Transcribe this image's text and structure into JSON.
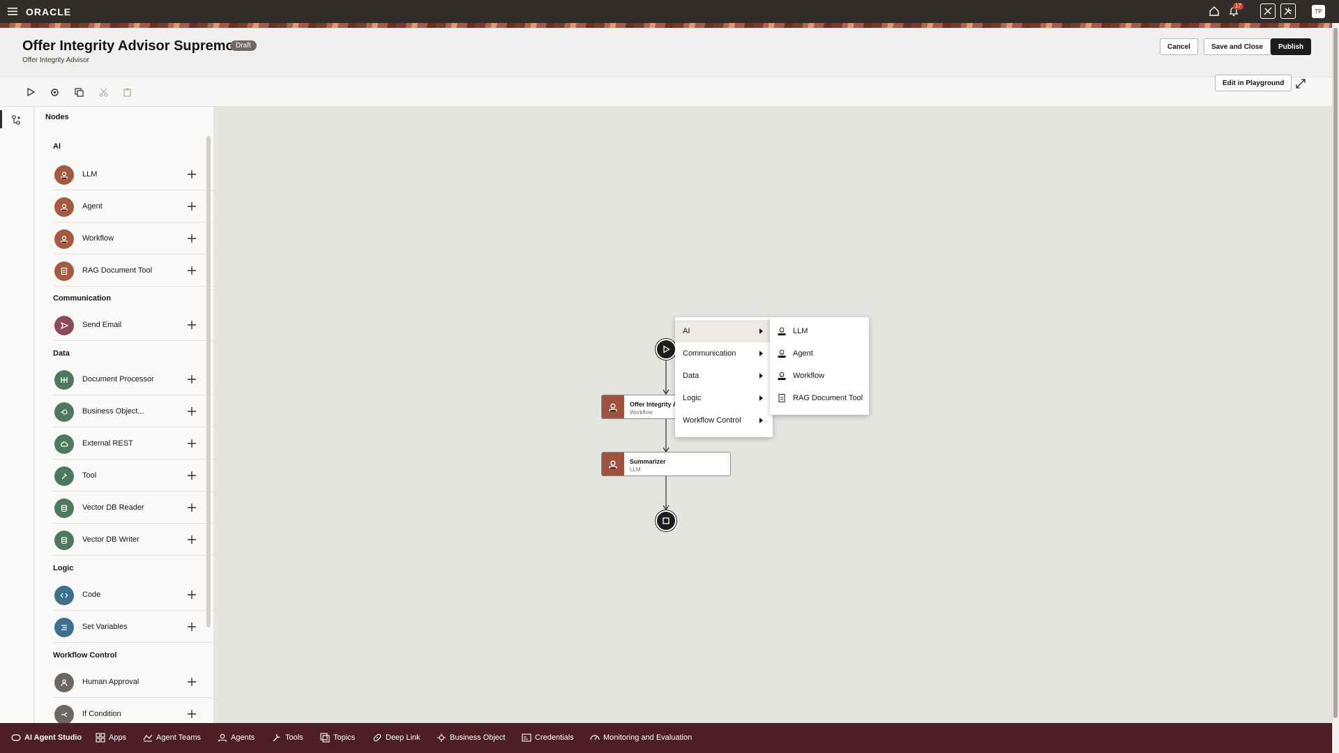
{
  "topbar": {
    "brand": "ORACLE",
    "notification_count": "17",
    "avatar_initials": "TP"
  },
  "header": {
    "title": "Offer Integrity Advisor Supremo",
    "status_badge": "Draft",
    "subtitle": "Offer Integrity Advisor",
    "cancel_label": "Cancel",
    "save_close_label": "Save and Close",
    "publish_label": "Publish"
  },
  "toolbar": {
    "edit_playground_label": "Edit in Playground"
  },
  "palette": {
    "title": "Nodes",
    "categories": {
      "ai": "AI",
      "communication": "Communication",
      "data": "Data",
      "logic": "Logic",
      "workflow_control": "Workflow Control"
    },
    "items": [
      {
        "label": "LLM",
        "icon": "llm-icon",
        "color": "#a35a41"
      },
      {
        "label": "Agent",
        "icon": "agent-icon",
        "color": "#a35a41"
      },
      {
        "label": "Workflow",
        "icon": "workflow-icon",
        "color": "#a35a41"
      },
      {
        "label": "RAG Document Tool",
        "icon": "rag-document-icon",
        "color": "#a35a41"
      },
      {
        "label": "Send Email",
        "icon": "send-icon",
        "color": "#8c4b5a"
      },
      {
        "label": "Document Processor",
        "icon": "document-processor-icon",
        "color": "#4d7a5e"
      },
      {
        "label": "Business Object...",
        "icon": "business-object-icon",
        "color": "#4d7a5e"
      },
      {
        "label": "External REST",
        "icon": "cloud-icon",
        "color": "#4d7a5e"
      },
      {
        "label": "Tool",
        "icon": "tool-icon",
        "color": "#4d7a5e"
      },
      {
        "label": "Vector DB Reader",
        "icon": "database-icon",
        "color": "#4d7a5e"
      },
      {
        "label": "Vector DB Writer",
        "icon": "database-icon",
        "color": "#4d7a5e"
      },
      {
        "label": "Code",
        "icon": "code-icon",
        "color": "#3f6f8e"
      },
      {
        "label": "Set Variables",
        "icon": "list-icon",
        "color": "#3f6f8e"
      },
      {
        "label": "Human Approval",
        "icon": "person-icon",
        "color": "#6b6762"
      },
      {
        "label": "If Condition",
        "icon": "branch-icon",
        "color": "#6b6762"
      }
    ]
  },
  "canvas": {
    "nodes": [
      {
        "title": "Offer Integrity Ac",
        "type": "Workflow"
      },
      {
        "title": "Summarizer",
        "type": "LLM"
      }
    ]
  },
  "context_menu": {
    "items": [
      "AI",
      "Communication",
      "Data",
      "Logic",
      "Workflow Control"
    ],
    "submenu": [
      "LLM",
      "Agent",
      "Workflow",
      "RAG Document Tool"
    ]
  },
  "bottom_nav": [
    {
      "label": "AI Agent Studio",
      "icon": "ai-studio-icon"
    },
    {
      "label": "Apps",
      "icon": "apps-icon"
    },
    {
      "label": "Agent Teams",
      "icon": "agent-teams-icon"
    },
    {
      "label": "Agents",
      "icon": "agents-icon"
    },
    {
      "label": "Tools",
      "icon": "tools-icon"
    },
    {
      "label": "Topics",
      "icon": "topics-icon"
    },
    {
      "label": "Deep Link",
      "icon": "link-icon"
    },
    {
      "label": "Business Object",
      "icon": "business-object-icon"
    },
    {
      "label": "Credentials",
      "icon": "credentials-icon"
    },
    {
      "label": "Monitoring and Evaluation",
      "icon": "monitoring-icon"
    }
  ]
}
